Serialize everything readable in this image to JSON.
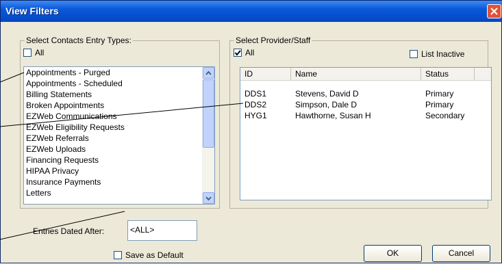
{
  "window": {
    "title": "View Filters"
  },
  "contacts": {
    "group_label": "Select Contacts Entry Types:",
    "all_label": "All",
    "all_checked": false,
    "items": [
      "Appointments - Purged",
      "Appointments - Scheduled",
      "Billing Statements",
      "Broken Appointments",
      "EZWeb Communications",
      "EZWeb Eligibility Requests",
      "EZWeb Referrals",
      "EZWeb Uploads",
      "Financing Requests",
      "HIPAA Privacy",
      "Insurance Payments",
      "Letters"
    ]
  },
  "providers": {
    "group_label": "Select Provider/Staff",
    "all_label": "All",
    "all_checked": true,
    "inactive_label": "List Inactive",
    "inactive_checked": false,
    "columns": [
      "ID",
      "Name",
      "Status"
    ],
    "rows": [
      {
        "id": "DDS1",
        "name": "Stevens, David D",
        "status": "Primary"
      },
      {
        "id": "DDS2",
        "name": "Simpson, Dale D",
        "status": "Primary"
      },
      {
        "id": "HYG1",
        "name": "Hawthorne, Susan H",
        "status": "Secondary"
      }
    ]
  },
  "entries": {
    "label": "Entries Dated After:",
    "value": "<ALL>"
  },
  "save_default": {
    "label": "Save as Default",
    "checked": false
  },
  "buttons": {
    "ok": "OK",
    "cancel": "Cancel"
  },
  "colors": {
    "title_bar": "#0a58d8",
    "dialog_bg": "#ece9d8",
    "close": "#e0533b"
  }
}
